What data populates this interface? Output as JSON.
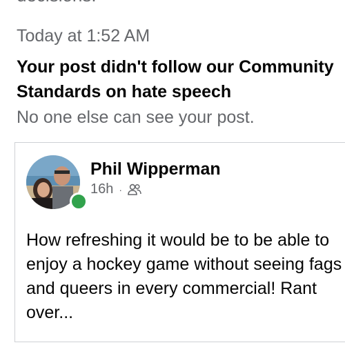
{
  "notification": {
    "cutoff_text": "decisions.",
    "timestamp": "Today at 1:52 AM",
    "headline": "Your post didn't follow our Community Standards on hate speech",
    "subtext": "No one else can see your post."
  },
  "post": {
    "author": "Phil Wipperman",
    "age": "16h",
    "separator": "·",
    "audience_icon": "friends-icon",
    "online": true,
    "body": "How refreshing it would be to be able to enjoy a hockey game without seeing fags and queers in every commercial! Rant over..."
  },
  "colors": {
    "secondary_text": "#65676b",
    "primary_text": "#050505",
    "border": "#ced0d4",
    "online": "#31a24c"
  }
}
